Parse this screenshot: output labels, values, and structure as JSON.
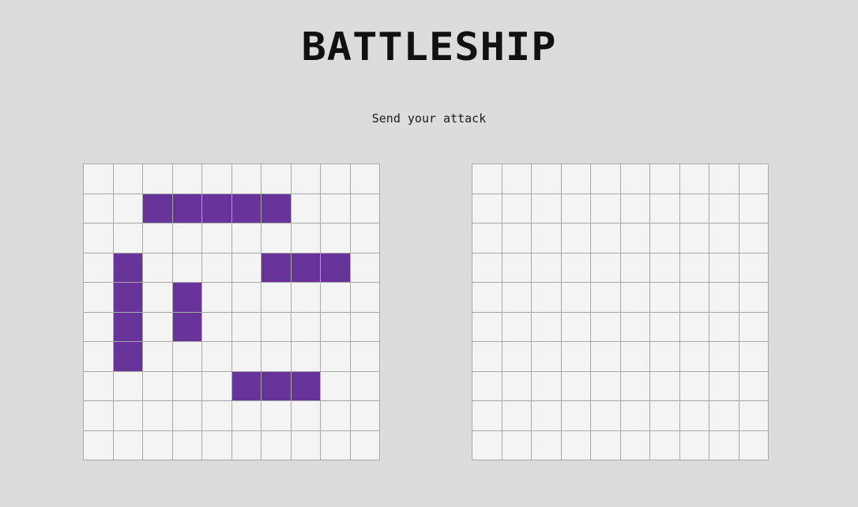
{
  "header": {
    "title": "BATTLESHIP"
  },
  "status": {
    "message": "Send your attack"
  },
  "colors": {
    "background": "#dcdcdc",
    "cell": "#f4f4f4",
    "grid_line": "#a8a8a8",
    "ship": "#663399"
  },
  "player_board": {
    "rows": 10,
    "cols": 10,
    "ships": [
      {
        "cells": [
          [
            1,
            2
          ],
          [
            1,
            3
          ],
          [
            1,
            4
          ],
          [
            1,
            5
          ],
          [
            1,
            6
          ]
        ]
      },
      {
        "cells": [
          [
            3,
            6
          ],
          [
            3,
            7
          ],
          [
            3,
            8
          ]
        ]
      },
      {
        "cells": [
          [
            3,
            1
          ],
          [
            4,
            1
          ],
          [
            5,
            1
          ],
          [
            6,
            1
          ]
        ]
      },
      {
        "cells": [
          [
            4,
            3
          ],
          [
            5,
            3
          ]
        ]
      },
      {
        "cells": [
          [
            7,
            5
          ],
          [
            7,
            6
          ],
          [
            7,
            7
          ]
        ]
      }
    ]
  },
  "enemy_board": {
    "rows": 10,
    "cols": 10
  }
}
